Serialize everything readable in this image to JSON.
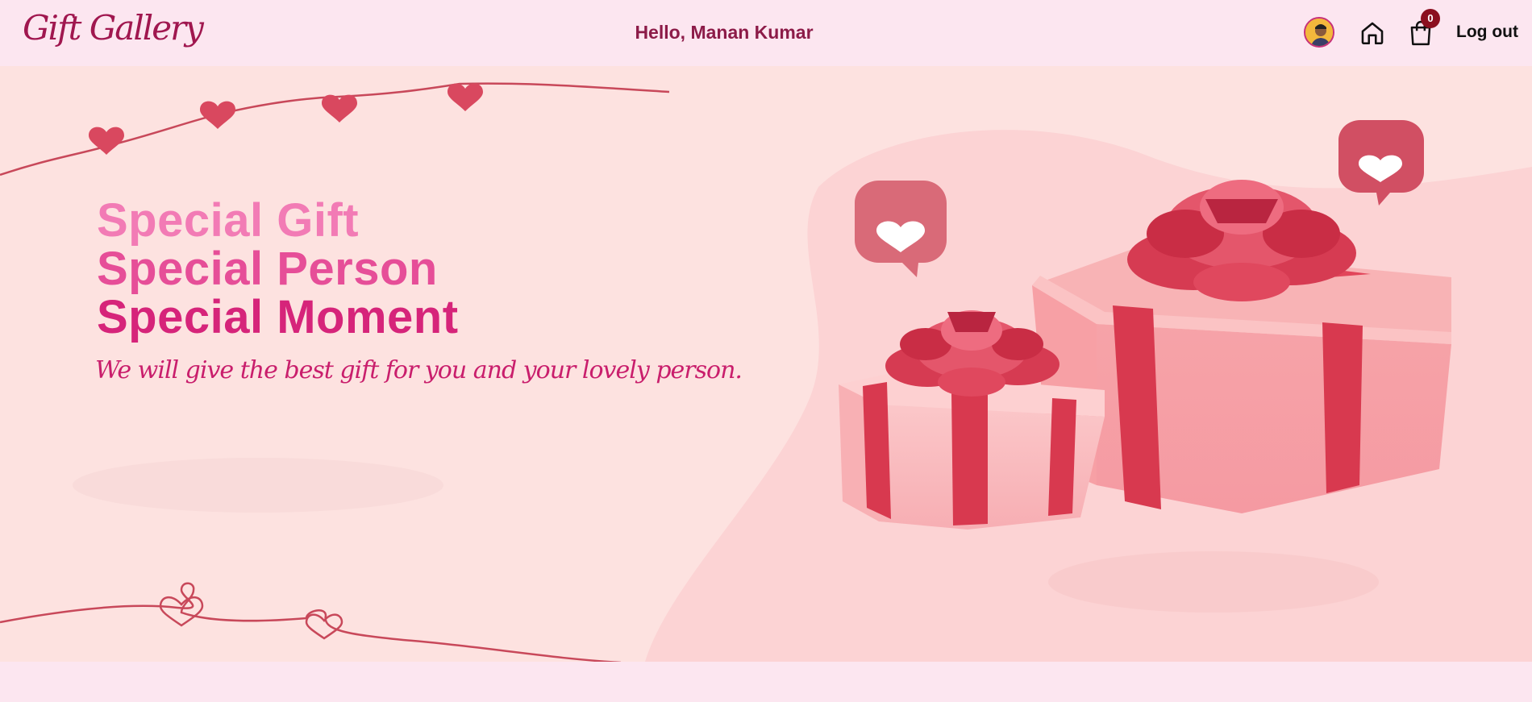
{
  "navbar": {
    "logo": "Gift Gallery",
    "greeting": "Hello, Manan Kumar",
    "cart_count": "0",
    "logout_label": "Log out"
  },
  "hero": {
    "line1": "Special Gift",
    "line2": "Special Person",
    "line3": "Special Moment",
    "tagline": "We will give the best gift for you and your lovely person."
  },
  "icons": [
    "avatar",
    "home-icon",
    "cart-icon"
  ],
  "colors": {
    "navbar_bg": "#fce6f0",
    "hero_bg": "#fde2e0",
    "brand": "#a0174f",
    "accent": "#d6247a",
    "badge": "#8b0f1f"
  }
}
